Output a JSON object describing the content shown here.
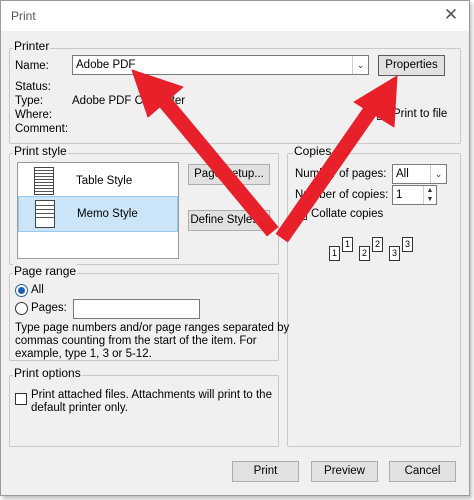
{
  "window": {
    "title": "Print"
  },
  "printer": {
    "group_label": "Printer",
    "name_label": "Name:",
    "name_value": "Adobe PDF",
    "properties_button": "Properties",
    "status_label": "Status:",
    "type_label": "Type:",
    "type_value": "Adobe PDF Converter",
    "where_label": "Where:",
    "comment_label": "Comment:",
    "print_to_file_label": "Print to file"
  },
  "print_style": {
    "group_label": "Print style",
    "items": [
      {
        "label": "Table Style",
        "selected": false
      },
      {
        "label": "Memo Style",
        "selected": true
      }
    ],
    "page_setup_button": "Page Setup...",
    "define_styles_button": "Define Styles..."
  },
  "copies": {
    "group_label": "Copies",
    "number_of_pages_label": "Number of pages:",
    "number_of_pages_value": "All",
    "number_of_copies_label": "Number of copies:",
    "number_of_copies_value": "1",
    "collate_label": "Collate copies",
    "collate_pages": [
      "1",
      "1",
      "2",
      "2",
      "3",
      "3"
    ]
  },
  "page_range": {
    "group_label": "Page range",
    "all_label": "All",
    "pages_label": "Pages:",
    "pages_value": "",
    "note_line1": "Type page numbers and/or page ranges separated by",
    "note_line2": "commas counting from the start of the item.  For",
    "note_line3": "example, type 1, 3 or 5-12."
  },
  "print_options": {
    "group_label": "Print options",
    "attach_line1": "Print attached files.  Attachments will print to the",
    "attach_line2": "default printer only."
  },
  "buttons": {
    "print": "Print",
    "preview": "Preview",
    "cancel": "Cancel"
  },
  "icons": {
    "close": "close-icon",
    "dropdown": "chevron-down-icon",
    "annotation": "red-arrow"
  },
  "colors": {
    "annotation_arrow": "#e8202a",
    "selection": "#cce4f7",
    "radio_on": "#1f5fb5"
  }
}
